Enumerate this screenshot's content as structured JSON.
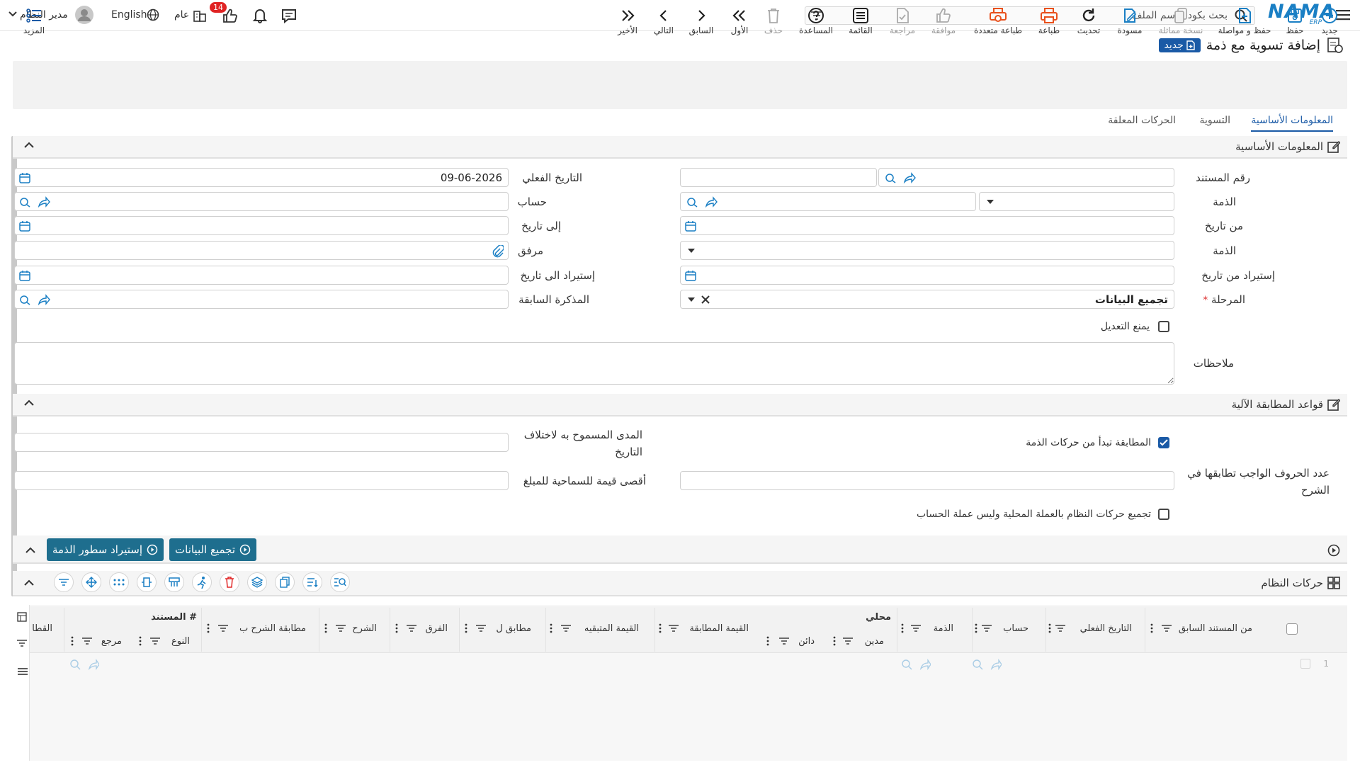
{
  "topbar": {
    "logo": "NAMA",
    "logo_sub": "ERP",
    "search_placeholder": "بحث بكود - اسم الملف",
    "language": "English",
    "user": "مدير النظام",
    "branch": "عام",
    "notif_count": "14"
  },
  "page": {
    "title": "إضافة تسوية مع ذمة",
    "badge": "جديد"
  },
  "toolbar": {
    "items": [
      {
        "label": "جديد",
        "icon": "plus-circle-icon"
      },
      {
        "label": "حفظ",
        "icon": "save-icon"
      },
      {
        "label": "حفظ و مواصلة",
        "icon": "save-continue-icon"
      },
      {
        "label": "نسخة مماثلة",
        "icon": "copy-icon"
      },
      {
        "label": "مسودة",
        "icon": "draft-icon"
      },
      {
        "label": "تحديث",
        "icon": "refresh-icon"
      },
      {
        "label": "طباعة",
        "icon": "print-icon"
      },
      {
        "label": "طباعة متعددة",
        "icon": "multi-print-icon"
      },
      {
        "label": "موافقة",
        "icon": "thumbs-up-icon"
      },
      {
        "label": "مراجعة",
        "icon": "review-icon"
      },
      {
        "label": "القائمة",
        "icon": "list-icon"
      },
      {
        "label": "المساعدة",
        "icon": "help-icon"
      },
      {
        "label": "حذف",
        "icon": "trash-icon"
      },
      {
        "label": "الأول",
        "icon": "first-icon"
      },
      {
        "label": "السابق",
        "icon": "prev-icon"
      },
      {
        "label": "التالي",
        "icon": "next-icon"
      },
      {
        "label": "الأخير",
        "icon": "last-icon"
      }
    ],
    "more": "المزيد"
  },
  "tabs": [
    "المعلومات الأساسية",
    "التسوية",
    "الحركات المعلقة"
  ],
  "section_basic": {
    "title": "المعلومات الأساسية",
    "doc_no": "رقم المستند",
    "actual_date": "التاريخ الفعلي",
    "actual_date_value": "09-06-2026",
    "account_party": "الذمة",
    "account": "حساب",
    "from_date": "من تاريخ",
    "to_date": "إلى تاريخ",
    "party2": "الذمة",
    "attachment": "مرفق",
    "import_from_date": "إستيراد من تاريخ",
    "import_to_date": "إستيراد الى تاريخ",
    "stage": "المرحلة",
    "stage_required": "*",
    "stage_value": "تجميع البيانات",
    "prev_note": "المذكرة السابقة",
    "prevent_edit": "يمنع التعديل",
    "notes": "ملاحظات"
  },
  "section_rules": {
    "title": "قواعد المطابقة الآلية",
    "match_from_party": "المطابقة تبدأ من حركات الذمة",
    "date_tolerance": "المدى المسموح به لاختلاف التاريخ",
    "chars_match": "عدد الحروف الواجب تطابقها في الشرح",
    "max_amount": "أقصى قيمة للسماحية للمبلغ",
    "group_local": "تجميع حركات النظام بالعملة المحلية وليس عملة الحساب"
  },
  "actions": {
    "collect": "تجميع البيانات",
    "import_lines": "إستيراد سطور الذمة"
  },
  "system_moves": {
    "title": "حركات النظام",
    "columns": [
      "من المستند السابق",
      "التاريخ الفعلي",
      "حساب",
      "الذمة",
      "محلي",
      "مدين",
      "دائن",
      "القيمة المطابقة",
      "القيمة المتبقيه",
      "مطابق ل",
      "الفرق",
      "الشرح",
      "مطابقة الشرح ب",
      "# المستند",
      "النوع",
      "مرجع",
      "القطا"
    ],
    "row_no": "1"
  }
}
